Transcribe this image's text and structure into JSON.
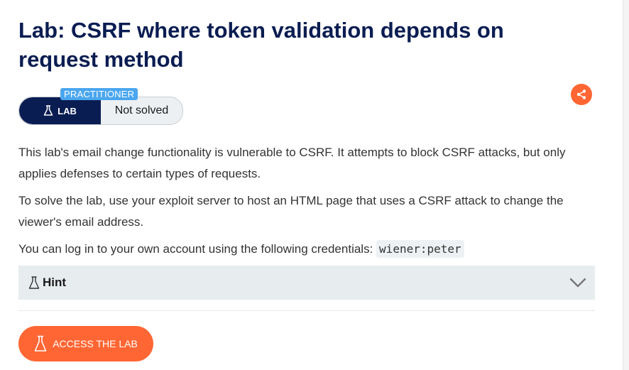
{
  "lab": {
    "title": "Lab: CSRF where token validation depends on request method",
    "level": "PRACTITIONER",
    "tag": "LAB",
    "status": "Not solved"
  },
  "description": {
    "p1": "This lab's email change functionality is vulnerable to CSRF. It attempts to block CSRF attacks, but only applies defenses to certain types of requests.",
    "p2": "To solve the lab, use your exploit server to host an HTML page that uses a CSRF attack to change the viewer's email address.",
    "p3": "You can log in to your own account using the following credentials:",
    "credentials": "wiener:peter"
  },
  "hint": {
    "label": "Hint"
  },
  "actions": {
    "access_label": "ACCESS THE LAB"
  },
  "icons": {
    "share": "share-icon",
    "flask": "flask-icon",
    "chevron": "chevron-down-icon"
  },
  "colors": {
    "title": "#0a1d52",
    "accent": "#ff6633",
    "badge": "#4aa6ef",
    "lab_tag": "#0a1d52"
  }
}
